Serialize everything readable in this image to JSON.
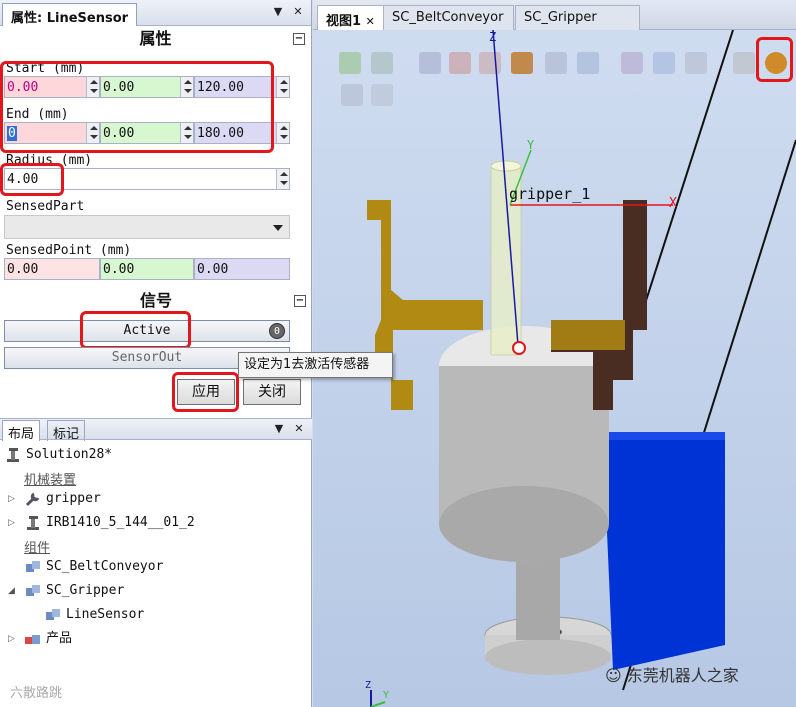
{
  "properties_panel": {
    "tab_title": "属性: LineSensor",
    "section_title": "属性",
    "start": {
      "label": "Start (mm)",
      "x": "0.00",
      "y": "0.00",
      "z": "120.00"
    },
    "end": {
      "label": "End (mm)",
      "x": "0",
      "y": "0.00",
      "z": "180.00"
    },
    "radius": {
      "label": "Radius (mm)",
      "value": "4.00"
    },
    "sensed_part": {
      "label": "SensedPart",
      "value": ""
    },
    "sensed_point": {
      "label": "SensedPoint (mm)",
      "x": "0.00",
      "y": "0.00",
      "z": "0.00"
    },
    "signals_title": "信号",
    "signal_active": {
      "label": "Active",
      "state": "0"
    },
    "signal_out": {
      "label": "SensorOut"
    },
    "tooltip": "设定为1去激活传感器",
    "apply_label": "应用",
    "close_label": "关闭"
  },
  "layout_panel": {
    "tabs": [
      "布局",
      "标记"
    ],
    "root": "Solution28*",
    "group_mechanism": "机械装置",
    "items_mech": [
      "gripper",
      "IRB1410_5_144__01_2"
    ],
    "group_components": "组件",
    "items_comp": [
      "SC_BeltConveyor",
      "SC_Gripper",
      "LineSensor",
      "产品"
    ]
  },
  "view": {
    "tabs": [
      "视图1",
      "SC_BeltConveyor",
      "SC_Gripper"
    ],
    "frame_label": "gripper_1",
    "axes": {
      "x": "X",
      "y": "Y",
      "z": "Z"
    },
    "watermark_right": "东莞机器人之家",
    "watermark_left": "六散路跳"
  },
  "colors": {
    "highlight": "#e3171b",
    "gripper": "#b08a12",
    "block": "#0033d6"
  }
}
